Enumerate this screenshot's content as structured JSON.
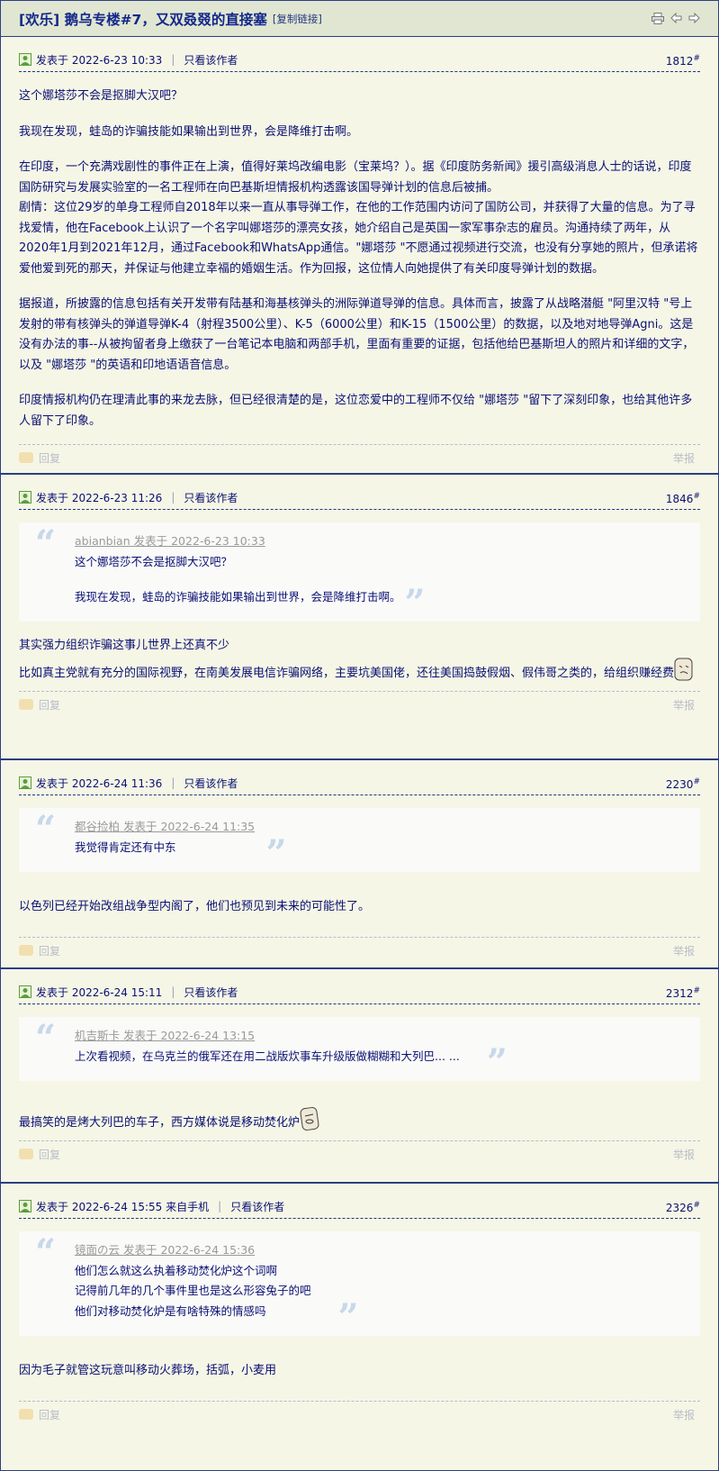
{
  "header": {
    "title": "[欢乐] 鹅乌专楼#7，又双叒叕的直接塞",
    "copy_link": "[复制链接]",
    "tools": [
      "print-icon",
      "prev-icon",
      "next-icon"
    ]
  },
  "common": {
    "sep": "|",
    "only_author": "只看该作者",
    "reply": "回复",
    "report": "举报",
    "floor_mark": "#"
  },
  "posts": [
    {
      "date": "发表于 2022-6-23 10:33",
      "floor": "1812",
      "paragraphs": [
        "这个娜塔莎不会是抠脚大汉吧？",
        "我现在发现，蛙岛的诈骗技能如果输出到世界，会是降维打击啊。",
        "在印度，一个充满戏剧性的事件正在上演，值得好莱坞改编电影（宝莱坞？）。据《印度防务新闻》援引高级消息人士的话说，印度国防研究与发展实验室的一名工程师在向巴基斯坦情报机构透露该国导弹计划的信息后被捕。",
        "剧情：这位29岁的单身工程师自2018年以来一直从事导弹工作，在他的工作范围内访问了国防公司，并获得了大量的信息。为了寻找爱情，他在Facebook上认识了一个名字叫娜塔莎的漂亮女孩，她介绍自己是英国一家军事杂志的雇员。沟通持续了两年，从2020年1月到2021年12月，通过Facebook和WhatsApp通信。\"娜塔莎 \"不愿通过视频进行交流，也没有分享她的照片，但承诺将爱他爱到死的那天，并保证与他建立幸福的婚姻生活。作为回报，这位情人向她提供了有关印度导弹计划的数据。",
        "据报道，所披露的信息包括有关开发带有陆基和海基核弹头的洲际弹道导弹的信息。具体而言，披露了从战略潜艇 \"阿里汉特 \"号上发射的带有核弹头的弹道导弹K-4（射程3500公里）、K-5（6000公里）和K-15（1500公里）的数据，以及地对地导弹Agni。这是没有办法的事--从被拘留者身上缴获了一台笔记本电脑和两部手机，里面有重要的证据，包括他给巴基斯坦人的照片和详细的文字，以及 \"娜塔莎 \"的英语和印地语语音信息。",
        "印度情报机构仍在理清此事的来龙去脉，但已经很清楚的是，这位恋爱中的工程师不仅给 \"娜塔莎 \"留下了深刻印象，也给其他许多人留下了印象。"
      ]
    },
    {
      "date": "发表于 2022-6-23 11:26",
      "floor": "1846",
      "quote": {
        "head": "abianbian 发表于 2022-6-23 10:33",
        "lines": [
          "这个娜塔莎不会是抠脚大汉吧？",
          "",
          "我现在发现，蛙岛的诈骗技能如果输出到世界，会是降维打击啊。"
        ]
      },
      "lines": [
        "其实强力组织诈骗这事儿世界上还真不少",
        "比如真主党就有充分的国际视野，在南美发展电信诈骗网络，主要坑美国佬，还往美国捣鼓假烟、假伟哥之类的，给组织赚经费"
      ]
    },
    {
      "date": "发表于 2022-6-24 11:36",
      "floor": "2230",
      "quote": {
        "head": "都谷捡柏 发表于 2022-6-24 11:35",
        "lines": [
          "我觉得肯定还有中东"
        ]
      },
      "lines": [
        "以色列已经开始改组战争型内阁了，他们也预见到未来的可能性了。"
      ]
    },
    {
      "date": "发表于 2022-6-24 15:11",
      "floor": "2312",
      "quote": {
        "head": "机吉斯卡 发表于 2022-6-24 13:15",
        "lines": [
          "上次看视频，在乌克兰的俄军还在用二战版炊事车升级版做糊糊和大列巴... ..."
        ]
      },
      "lines": [
        "最搞笑的是烤大列巴的车子，西方媒体说是移动焚化炉"
      ]
    },
    {
      "date": "发表于 2022-6-24 15:55 来自手机",
      "floor": "2326",
      "quote": {
        "head": "镜面の云 发表于 2022-6-24 15:36",
        "lines": [
          "他们怎么就这么执着移动焚化炉这个词啊",
          "记得前几年的几个事件里也是这么形容兔子的吧",
          "他们对移动焚化炉是有啥特殊的情感吗"
        ]
      },
      "lines": [
        "因为毛子就管这玩意叫移动火葬场，括弧，小麦用"
      ]
    }
  ]
}
